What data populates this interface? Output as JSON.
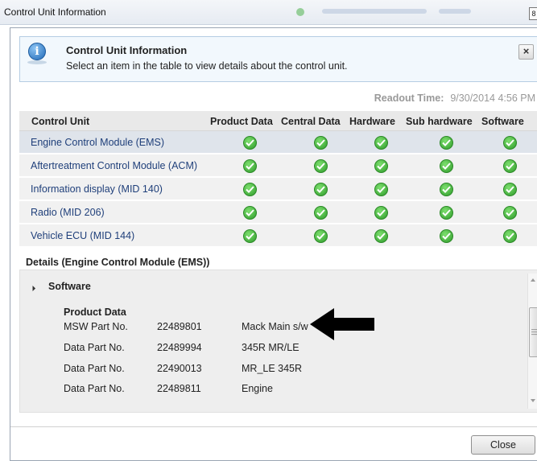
{
  "window": {
    "title": "Control Unit Information"
  },
  "info": {
    "title": "Control Unit Information",
    "subtitle": "Select an item in the table to view details about the control unit.",
    "close_label": "×"
  },
  "readout": {
    "label": "Readout Time:",
    "value": "9/30/2014 4:56 PM"
  },
  "table": {
    "columns": [
      "Control Unit",
      "Product Data",
      "Central Data",
      "Hardware",
      "Sub hardware",
      "Software"
    ],
    "rows": [
      {
        "name": "Engine Control Module (EMS)",
        "selected": true,
        "checks": [
          true,
          true,
          true,
          true,
          true
        ]
      },
      {
        "name": "Aftertreatment Control Module (ACM)",
        "selected": false,
        "checks": [
          true,
          true,
          true,
          true,
          true
        ]
      },
      {
        "name": "Information display (MID 140)",
        "selected": false,
        "checks": [
          true,
          true,
          true,
          true,
          true
        ]
      },
      {
        "name": "Radio (MID 206)",
        "selected": false,
        "checks": [
          true,
          true,
          true,
          true,
          true
        ]
      },
      {
        "name": "Vehicle ECU (MID 144)",
        "selected": false,
        "checks": [
          true,
          true,
          true,
          true,
          true
        ]
      }
    ],
    "check_icon": "green-check-circle-icon",
    "check_color": "#3aaa35"
  },
  "details": {
    "title": "Details (Engine Control Module (EMS))",
    "section": "Software",
    "group": "Product Data",
    "rows": [
      {
        "label": "MSW Part No.",
        "number": "22489801",
        "desc": "Mack Main s/w"
      },
      {
        "label": "Data Part No.",
        "number": "22489994",
        "desc": "345R MR/LE"
      },
      {
        "label": "Data Part No.",
        "number": "22490013",
        "desc": "MR_LE 345R"
      },
      {
        "label": "Data Part No.",
        "number": "22489811",
        "desc": "Engine"
      }
    ]
  },
  "footer": {
    "close_label": "Close"
  }
}
